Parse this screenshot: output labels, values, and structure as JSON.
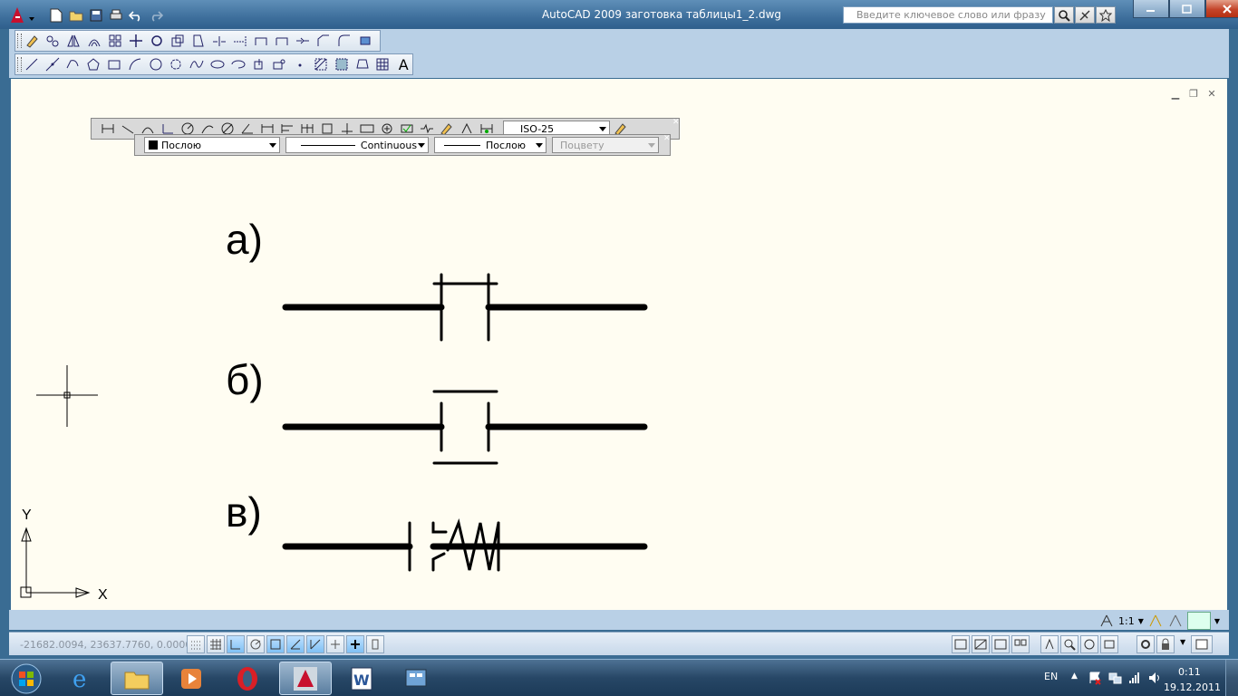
{
  "window": {
    "title": "AutoCAD 2009 заготовка таблицы1_2.dwg",
    "search_placeholder": "Введите ключевое слово или фразу"
  },
  "quick_access": [
    "new-icon",
    "open-icon",
    "save-icon",
    "print-icon",
    "undo-icon",
    "redo-icon"
  ],
  "toolbar_modify_icons": [
    "erase-icon",
    "copy-icon",
    "mirror-icon",
    "offset-icon",
    "array-icon",
    "move-icon",
    "rotate-icon",
    "scale-icon",
    "stretch-icon",
    "trim-icon",
    "extend-icon",
    "break-at-point-icon",
    "break-icon",
    "join-icon",
    "chamfer-icon",
    "fillet-icon",
    "explode-icon"
  ],
  "toolbar_draw_icons": [
    "line-icon",
    "construction-line-icon",
    "polyline-icon",
    "polygon-icon",
    "rectangle-icon",
    "arc-icon",
    "circle-icon",
    "revision-cloud-icon",
    "spline-icon",
    "ellipse-icon",
    "ellipse-arc-icon",
    "insert-block-icon",
    "make-block-icon",
    "point-icon",
    "hatch-icon",
    "gradient-icon",
    "region-icon",
    "table-icon",
    "multiline-text-icon"
  ],
  "dim_toolbar": {
    "style": "ISO-25"
  },
  "props_toolbar": {
    "color": "Послою",
    "linetype": "Continuous",
    "lineweight": "Послою",
    "plotstyle": "Поцвету"
  },
  "drawing": {
    "labels": [
      "а)",
      "б)",
      "в)"
    ],
    "ucs_x": "X",
    "ucs_y": "Y"
  },
  "status": {
    "coords": "-21682.0094, 23637.7760, 0.0000",
    "annotation_scale": "1:1"
  },
  "taskbar": {
    "apps": [
      "explorer-icon",
      "internet-explorer-icon",
      "folder-icon",
      "media-player-icon",
      "opera-icon",
      "autocad-icon",
      "word-icon",
      "control-panel-icon"
    ],
    "lang": "EN",
    "time": "0:11",
    "date": "19.12.2011"
  },
  "colors": {
    "drawing_bg": "#fffdf2",
    "title_bar": "#3e6f9c",
    "close_button": "#c4452a"
  }
}
